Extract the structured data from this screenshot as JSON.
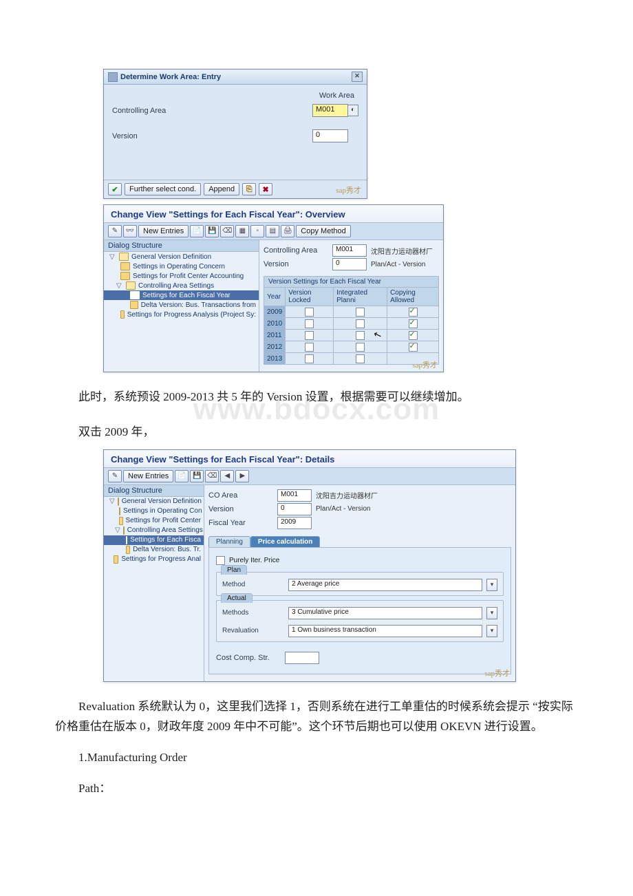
{
  "watermark": "www.bdocx.com",
  "dialog1": {
    "title": "Determine Work Area: Entry",
    "work_area_label": "Work Area",
    "controlling_area_label": "Controlling Area",
    "controlling_area_value": "M001",
    "version_label": "Version",
    "version_value": "0",
    "btn_check_tip": "✓",
    "btn_further": "Further select cond.",
    "btn_append": "Append",
    "logo": "sap秀才"
  },
  "panel2": {
    "title": "Change View \"Settings for Each Fiscal Year\": Overview",
    "toolbar_new": "New Entries",
    "toolbar_copy": "Copy Method",
    "tree_head": "Dialog Structure",
    "tree": {
      "t1": "General Version Definition",
      "t2": "Settings in Operating Concern",
      "t3": "Settings for Profit Center Accounting",
      "t4": "Controlling Area Settings",
      "t5": "Settings for Each Fiscal Year",
      "t6": "Delta Version: Bus. Transactions from",
      "t7": "Settings for Progress Analysis (Project Sy:"
    },
    "ca_label": "Controlling Area",
    "ca_value": "M001",
    "ca_text": "沈阳吉力运动器材厂",
    "ver_label": "Version",
    "ver_value": "0",
    "ver_text": "Plan/Act - Version",
    "sub_head": "Version Settings for Each Fiscal Year",
    "cols": [
      "Year",
      "Version Locked",
      "Integrated Planni",
      "Copying Allowed"
    ],
    "rows": [
      {
        "year": "2009",
        "locked": false,
        "int": false,
        "copy": true
      },
      {
        "year": "2010",
        "locked": false,
        "int": false,
        "copy": true
      },
      {
        "year": "2011",
        "locked": false,
        "int": false,
        "copy": true
      },
      {
        "year": "2012",
        "locked": false,
        "int": false,
        "copy": true
      },
      {
        "year": "2013",
        "locked": false,
        "int": false,
        "copy": false
      }
    ],
    "logo": "sap秀才"
  },
  "para1": "此时，系统预设 2009-2013 共 5 年的 Version 设置，根据需要可以继续增加。",
  "para2": "双击 2009 年，",
  "panel3": {
    "title": "Change View \"Settings for Each Fiscal Year\": Details",
    "toolbar_new": "New Entries",
    "tree_head": "Dialog Structure",
    "tree": {
      "t1": "General Version Definition",
      "t2": "Settings in Operating Con",
      "t3": "Settings for Profit Center",
      "t4": "Controlling Area Settings",
      "t5": "Settings for Each Fisca",
      "t6": "Delta Version: Bus. Tr.",
      "t7": "Settings for Progress Anal"
    },
    "co_area_label": "CO Area",
    "co_area_value": "M001",
    "co_area_text": "沈阳吉力运动器材厂",
    "ver_label": "Version",
    "ver_value": "0",
    "ver_text": "Plan/Act - Version",
    "fy_label": "Fiscal Year",
    "fy_value": "2009",
    "tab_plan": "Planning",
    "tab_price": "Price calculation",
    "purely": "Purely Iter. Price",
    "g_plan": "Plan",
    "g_plan_method_label": "Method",
    "g_plan_method_value": "2 Average price",
    "g_actual": "Actual",
    "g_actual_methods_label": "Methods",
    "g_actual_methods_value": "3 Cumulative price",
    "g_actual_reval_label": "Revaluation",
    "g_actual_reval_value": "1 Own business transaction",
    "ccs_label": "Cost Comp. Str.",
    "logo": "sap秀才"
  },
  "para3": "Revaluation 系统默认为 0，这里我们选择 1，否则系统在进行工单重估的时候系统会提示 “按实际价格重估在版本 0，财政年度 2009 年中不可能”。这个环节后期也可以使用 OKEVN 进行设置。",
  "para4": "1.Manufacturing Order",
  "para5": "Path："
}
